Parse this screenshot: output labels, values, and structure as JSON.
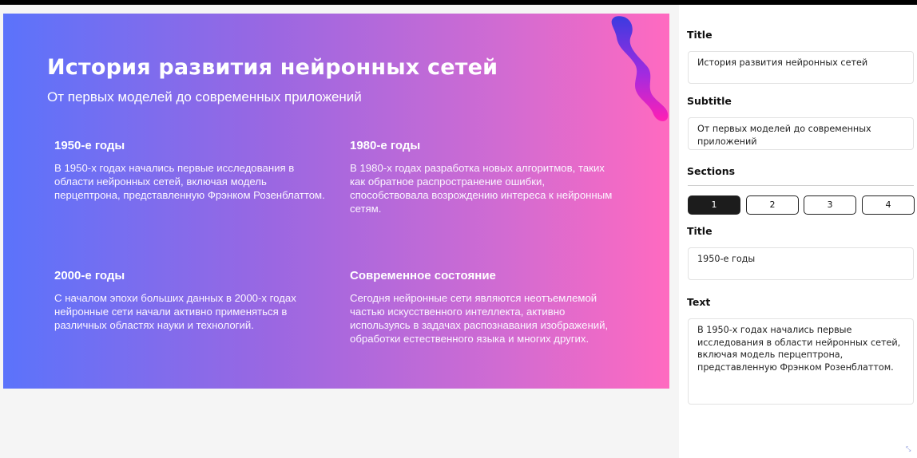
{
  "slide": {
    "title": "История развития нейронных сетей",
    "subtitle": "От первых моделей до современных приложений",
    "gradient_colors": [
      "#5b73fb",
      "#9a67e2",
      "#d16bd2",
      "#ff6ac0"
    ],
    "sections": [
      {
        "title": "1950-е годы",
        "text": "В 1950-х годах начались первые исследования в области нейронных сетей, включая модель перцептрона, представленную Фрэнком Розенблаттом."
      },
      {
        "title": "1980-е годы",
        "text": "В 1980-х годах разработка новых алгоритмов, таких как обратное распространение ошибки, способствовала возрождению интереса к нейронным сетям."
      },
      {
        "title": "2000-е годы",
        "text": "С началом эпохи больших данных в 2000-х годах нейронные сети начали активно применяться в различных областях науки и технологий."
      },
      {
        "title": "Современное состояние",
        "text": "Сегодня нейронные сети являются неотъемлемой частью искусственного интеллекта, активно используясь в задачах распознавания изображений, обработки естественного языка и многих других."
      }
    ]
  },
  "panel": {
    "title_label": "Title",
    "title_value": "История развития нейронных сетей",
    "subtitle_label": "Subtitle",
    "subtitle_value": "От первых моделей до современных приложений",
    "sections_label": "Sections",
    "tabs": [
      "1",
      "2",
      "3",
      "4"
    ],
    "active_tab": "1",
    "section_title_label": "Title",
    "section_title_value": "1950-е годы",
    "text_label": "Text",
    "text_value": "В 1950-х годах начались первые исследования в области нейронных сетей, включая модель перцептрона, представленную Фрэнком Розенблаттом."
  },
  "icons": {
    "corner": "resize-handle-icon"
  }
}
